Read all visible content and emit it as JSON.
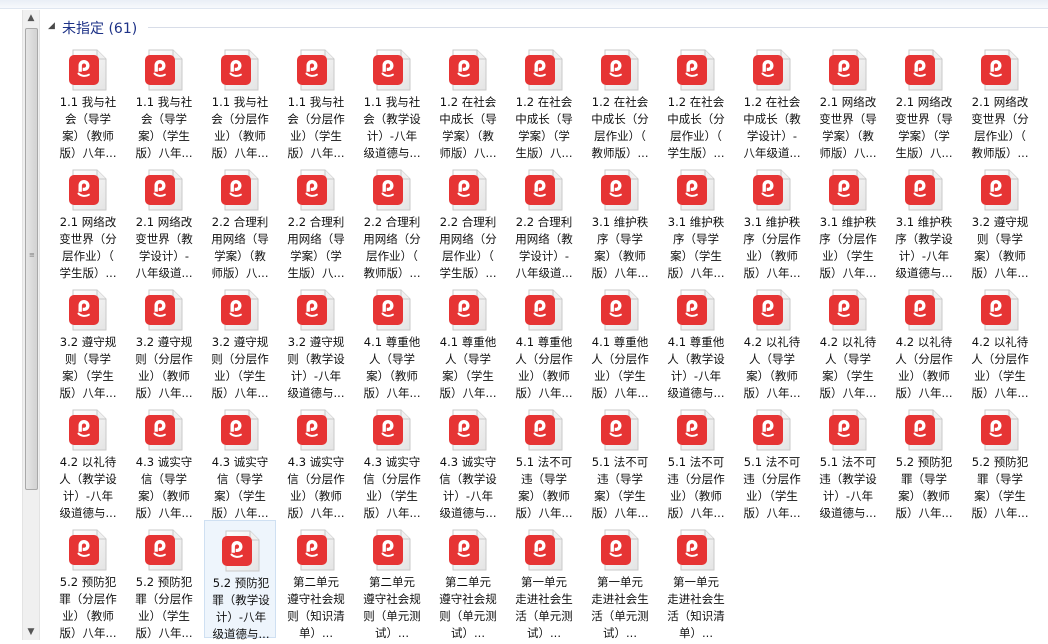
{
  "group": {
    "title": "未指定 (61)"
  },
  "icons": {
    "file": "pdf-file-icon",
    "collapse": "collapse-triangle-icon"
  },
  "colors": {
    "pdf_red": "#e63434",
    "header_text": "#1e3287"
  },
  "files": [
    {
      "lines": [
        "1.1 我与社",
        "会（导学",
        "案）（教师",
        "版）八年..."
      ]
    },
    {
      "lines": [
        "1.1 我与社",
        "会（导学",
        "案）（学生",
        "版）八年..."
      ]
    },
    {
      "lines": [
        "1.1 我与社",
        "会（分层作",
        "业）（教师",
        "版）八年..."
      ]
    },
    {
      "lines": [
        "1.1 我与社",
        "会（分层作",
        "业）（学生",
        "版）八年..."
      ]
    },
    {
      "lines": [
        "1.1 我与社",
        "会（教学设",
        "计）-八年",
        "级道德与..."
      ]
    },
    {
      "lines": [
        "1.2 在社会",
        "中成长（导",
        "学案）（教",
        "师版）八..."
      ]
    },
    {
      "lines": [
        "1.2 在社会",
        "中成长（导",
        "学案）（学",
        "生版）八..."
      ]
    },
    {
      "lines": [
        "1.2 在社会",
        "中成长（分",
        "层作业）（",
        "教师版）..."
      ]
    },
    {
      "lines": [
        "1.2 在社会",
        "中成长（分",
        "层作业）（",
        "学生版）..."
      ]
    },
    {
      "lines": [
        "1.2 在社会",
        "中成长（教",
        "学设计）-",
        "八年级道..."
      ]
    },
    {
      "lines": [
        "2.1 网络改",
        "变世界（导",
        "学案）（教",
        "师版）八..."
      ]
    },
    {
      "lines": [
        "2.1 网络改",
        "变世界（导",
        "学案）（学",
        "生版）八..."
      ]
    },
    {
      "lines": [
        "2.1 网络改",
        "变世界（分",
        "层作业）（",
        "教师版）..."
      ]
    },
    {
      "lines": [
        "2.1 网络改",
        "变世界（分",
        "层作业）（",
        "学生版）..."
      ]
    },
    {
      "lines": [
        "2.1 网络改",
        "变世界（教",
        "学设计）-",
        "八年级道..."
      ]
    },
    {
      "lines": [
        "2.2 合理利",
        "用网络（导",
        "学案）（教",
        "师版）八..."
      ]
    },
    {
      "lines": [
        "2.2 合理利",
        "用网络（导",
        "学案）（学",
        "生版）八..."
      ]
    },
    {
      "lines": [
        "2.2 合理利",
        "用网络（分",
        "层作业）（",
        "教师版）..."
      ]
    },
    {
      "lines": [
        "2.2 合理利",
        "用网络（分",
        "层作业）（",
        "学生版）..."
      ]
    },
    {
      "lines": [
        "2.2 合理利",
        "用网络（教",
        "学设计）-",
        "八年级道..."
      ]
    },
    {
      "lines": [
        "3.1 维护秩",
        "序（导学",
        "案）（教师",
        "版）八年..."
      ]
    },
    {
      "lines": [
        "3.1 维护秩",
        "序（导学",
        "案）（学生",
        "版）八年..."
      ]
    },
    {
      "lines": [
        "3.1 维护秩",
        "序（分层作",
        "业）（教师",
        "版）八年..."
      ]
    },
    {
      "lines": [
        "3.1 维护秩",
        "序（分层作",
        "业）（学生",
        "版）八年..."
      ]
    },
    {
      "lines": [
        "3.1 维护秩",
        "序（教学设",
        "计）-八年",
        "级道德与..."
      ]
    },
    {
      "lines": [
        "3.2 遵守规",
        "则（导学",
        "案）（教师",
        "版）八年..."
      ]
    },
    {
      "lines": [
        "3.2 遵守规",
        "则（导学",
        "案）（学生",
        "版）八年..."
      ]
    },
    {
      "lines": [
        "3.2 遵守规",
        "则（分层作",
        "业）（教师",
        "版）八年..."
      ]
    },
    {
      "lines": [
        "3.2 遵守规",
        "则（分层作",
        "业）（学生",
        "版）八年..."
      ]
    },
    {
      "lines": [
        "3.2 遵守规",
        "则（教学设",
        "计）-八年",
        "级道德与..."
      ]
    },
    {
      "lines": [
        "4.1 尊重他",
        "人（导学",
        "案）（教师",
        "版）八年..."
      ]
    },
    {
      "lines": [
        "4.1 尊重他",
        "人（导学",
        "案）（学生",
        "版）八年..."
      ]
    },
    {
      "lines": [
        "4.1 尊重他",
        "人（分层作",
        "业）（教师",
        "版）八年..."
      ]
    },
    {
      "lines": [
        "4.1 尊重他",
        "人（分层作",
        "业）（学生",
        "版）八年..."
      ]
    },
    {
      "lines": [
        "4.1 尊重他",
        "人（教学设",
        "计）-八年",
        "级道德与..."
      ]
    },
    {
      "lines": [
        "4.2 以礼待",
        "人（导学",
        "案）（教师",
        "版）八年..."
      ]
    },
    {
      "lines": [
        "4.2 以礼待",
        "人（导学",
        "案）（学生",
        "版）八年..."
      ]
    },
    {
      "lines": [
        "4.2 以礼待",
        "人（分层作",
        "业）（教师",
        "版）八年..."
      ]
    },
    {
      "lines": [
        "4.2 以礼待",
        "人（分层作",
        "业）（学生",
        "版）八年..."
      ]
    },
    {
      "lines": [
        "4.2 以礼待",
        "人（教学设",
        "计）-八年",
        "级道德与..."
      ]
    },
    {
      "lines": [
        "4.3 诚实守",
        "信（导学",
        "案）（教师",
        "版）八年..."
      ]
    },
    {
      "lines": [
        "4.3 诚实守",
        "信（导学",
        "案）（学生",
        "版）八年..."
      ]
    },
    {
      "lines": [
        "4.3 诚实守",
        "信（分层作",
        "业）（教师",
        "版）八年..."
      ]
    },
    {
      "lines": [
        "4.3 诚实守",
        "信（分层作",
        "业）（学生",
        "版）八年..."
      ]
    },
    {
      "lines": [
        "4.3 诚实守",
        "信（教学设",
        "计）-八年",
        "级道德与..."
      ]
    },
    {
      "lines": [
        "5.1 法不可",
        "违（导学",
        "案）（教师",
        "版）八年..."
      ]
    },
    {
      "lines": [
        "5.1 法不可",
        "违（导学",
        "案）（学生",
        "版）八年..."
      ]
    },
    {
      "lines": [
        "5.1 法不可",
        "违（分层作",
        "业）（教师",
        "版）八年..."
      ]
    },
    {
      "lines": [
        "5.1 法不可",
        "违（分层作",
        "业）（学生",
        "版）八年..."
      ]
    },
    {
      "lines": [
        "5.1 法不可",
        "违（教学设",
        "计）-八年",
        "级道德与..."
      ]
    },
    {
      "lines": [
        "5.2 预防犯",
        "罪（导学",
        "案）（教师",
        "版）八年..."
      ]
    },
    {
      "lines": [
        "5.2 预防犯",
        "罪（导学",
        "案）（学生",
        "版）八年..."
      ]
    },
    {
      "lines": [
        "5.2 预防犯",
        "罪（分层作",
        "业）（教师",
        "版）八年..."
      ]
    },
    {
      "lines": [
        "5.2 预防犯",
        "罪（分层作",
        "业）（学生",
        "版）八年..."
      ]
    },
    {
      "lines": [
        "5.2 预防犯",
        "罪（教学设",
        "计）-八年",
        "级道德与..."
      ],
      "selected": true
    },
    {
      "lines": [
        "第二单元",
        "遵守社会规",
        "则（知识清",
        "单）..."
      ]
    },
    {
      "lines": [
        "第二单元",
        "遵守社会规",
        "则（单元测",
        "试）..."
      ]
    },
    {
      "lines": [
        "第二单元",
        "遵守社会规",
        "则（单元测",
        "试）..."
      ]
    },
    {
      "lines": [
        "第一单元",
        "走进社会生",
        "活（单元测",
        "试）..."
      ]
    },
    {
      "lines": [
        "第一单元",
        "走进社会生",
        "活（单元测",
        "试）..."
      ]
    },
    {
      "lines": [
        "第一单元",
        "走进社会生",
        "活（知识清",
        "单）..."
      ]
    }
  ]
}
